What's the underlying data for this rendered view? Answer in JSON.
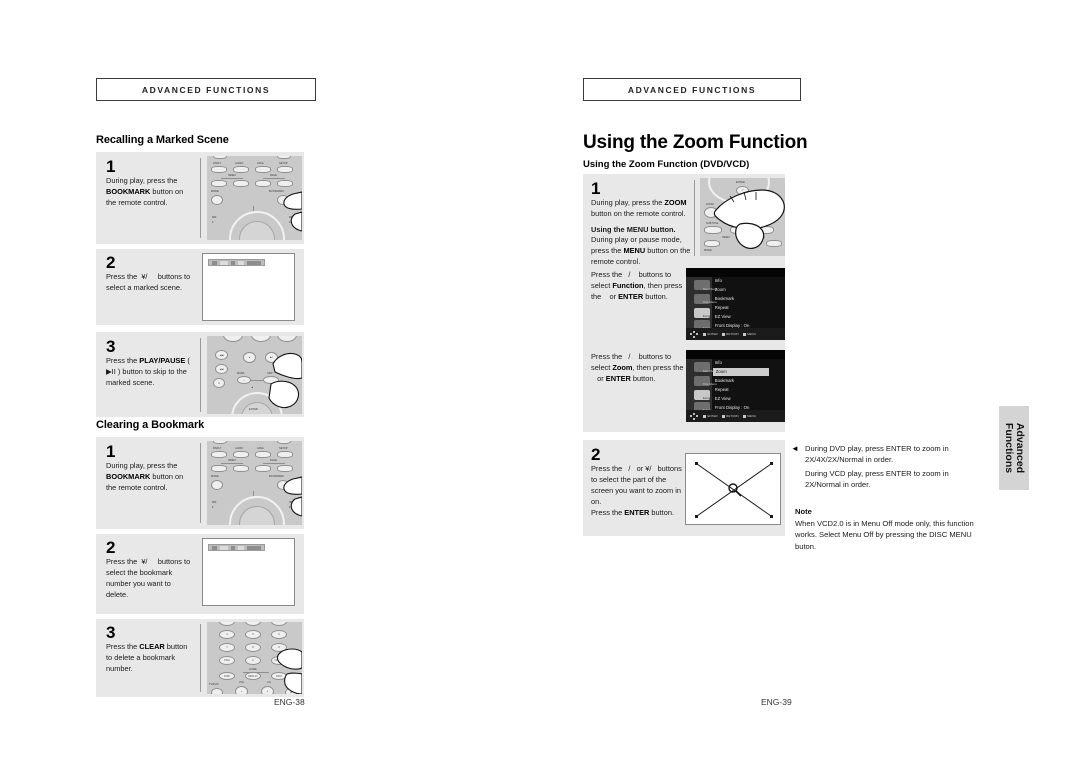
{
  "spread": {
    "left_page": {
      "banner": "ADVANCED FUNCTIONS",
      "page_number": "ENG-38",
      "sections": [
        {
          "heading": "Recalling a Marked Scene",
          "steps": [
            {
              "number": "1",
              "text_html": "During play, press the <b>BOOKMARK</b> button on the remote control.",
              "visual": "remote-bookmark"
            },
            {
              "number": "2",
              "text_html": "Press the ¥/    buttons to select a marked scene.",
              "visual": "tv-osd-bar"
            },
            {
              "number": "3",
              "text_html": "Press the <b>PLAY/PAUSE</b> ( ▶II ) button to skip to the marked scene.",
              "visual": "remote-playpause"
            }
          ]
        },
        {
          "heading": "Clearing a Bookmark",
          "steps": [
            {
              "number": "1",
              "text_html": "During play, press the <b>BOOKMARK</b> button on the remote control.",
              "visual": "remote-bookmark"
            },
            {
              "number": "2",
              "text_html": "Press the ¥/    buttons to select the bookmark number you want to delete.",
              "visual": "tv-osd-bar"
            },
            {
              "number": "3",
              "text_html": "Press the <b>CLEAR</b> button to delete a bookmark number.",
              "visual": "remote-keypad"
            }
          ]
        }
      ]
    },
    "right_page": {
      "banner": "ADVANCED FUNCTIONS",
      "title": "Using the Zoom Function",
      "subtitle": "Using the Zoom Function (DVD/VCD)",
      "page_number": "ENG-39",
      "steps": [
        {
          "number": "1",
          "text_html": "During play, press the <b>ZOOM</b> button on the remote control.",
          "subhead": "Using the MENU button.",
          "text2_html": "During play or pause mode, press the <b>MENU</b> button on the remote control.",
          "text3_html": "Press the   /   buttons to select <b>Function</b>, then press the    or <b>ENTER</b> button.",
          "text4_html": "Press the   /   buttons to select <b>Zoom</b>, then press the    or <b>ENTER</b> button."
        },
        {
          "number": "2",
          "text_html": "Press the   /   or ¥/   buttons to select the part of the screen you want to zoom in on. Press the <b>ENTER</b> button."
        }
      ],
      "osd_menu": {
        "items": [
          "Info",
          "Zoom",
          "Bookmark",
          "Repeat",
          "EZ View",
          "Front Display : On"
        ],
        "side_labels": [
          "Disc Menu",
          "Title Menu",
          "Function",
          "Setup"
        ],
        "selected_item_first": "",
        "selected_item_second": "Zoom",
        "footer_tags": [
          "ENTER",
          "RETURN",
          "MENU"
        ]
      },
      "notes": {
        "bullets": [
          "During DVD play, press ENTER to zoom in 2X/4X/2X/Normal in order.",
          "During VCD play, press ENTER to zoom in 2X/Normal in order."
        ],
        "note_heading": "Note",
        "note_body": "When VCD2.0 is in Menu Off mode only, this function works. Select Menu Off by pressing the DISC MENU buton."
      }
    },
    "side_tab": {
      "line1": "Advanced",
      "line2": "Functions"
    }
  }
}
